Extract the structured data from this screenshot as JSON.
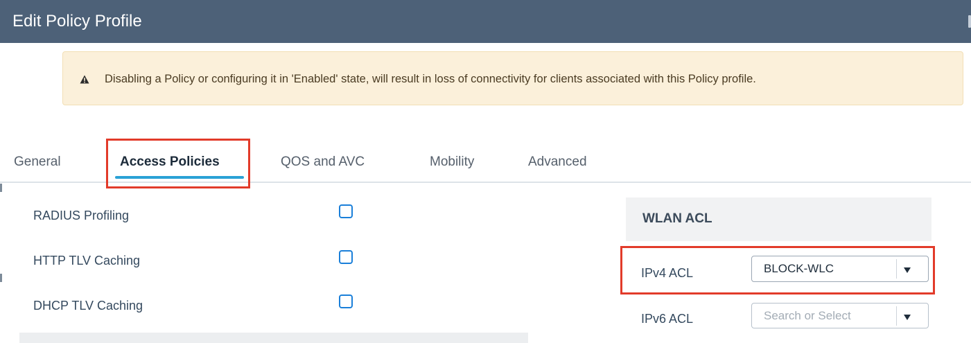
{
  "dialog": {
    "title": "Edit Policy Profile"
  },
  "alert": {
    "icon": "warning-triangle-icon",
    "message": "Disabling a Policy or configuring it in 'Enabled' state, will result in loss of connectivity for clients associated with this Policy profile."
  },
  "tabs": [
    {
      "label": "General",
      "active": false
    },
    {
      "label": "Access Policies",
      "active": true
    },
    {
      "label": "QOS and AVC",
      "active": false
    },
    {
      "label": "Mobility",
      "active": false
    },
    {
      "label": "Advanced",
      "active": false
    }
  ],
  "options": [
    {
      "label": "RADIUS Profiling",
      "checked": false
    },
    {
      "label": "HTTP TLV Caching",
      "checked": false
    },
    {
      "label": "DHCP TLV Caching",
      "checked": false
    }
  ],
  "wlan_acl": {
    "title": "WLAN ACL",
    "ipv4": {
      "label": "IPv4 ACL",
      "value": "BLOCK-WLC"
    },
    "ipv6": {
      "label": "IPv6 ACL",
      "placeholder": "Search or Select"
    }
  },
  "colors": {
    "header_bg": "#4d6178",
    "active_tab_underline": "#2aa2d6",
    "highlight_box": "#e23b2a",
    "checkbox_border": "#1a7fd9",
    "alert_bg": "#fbf0da"
  }
}
